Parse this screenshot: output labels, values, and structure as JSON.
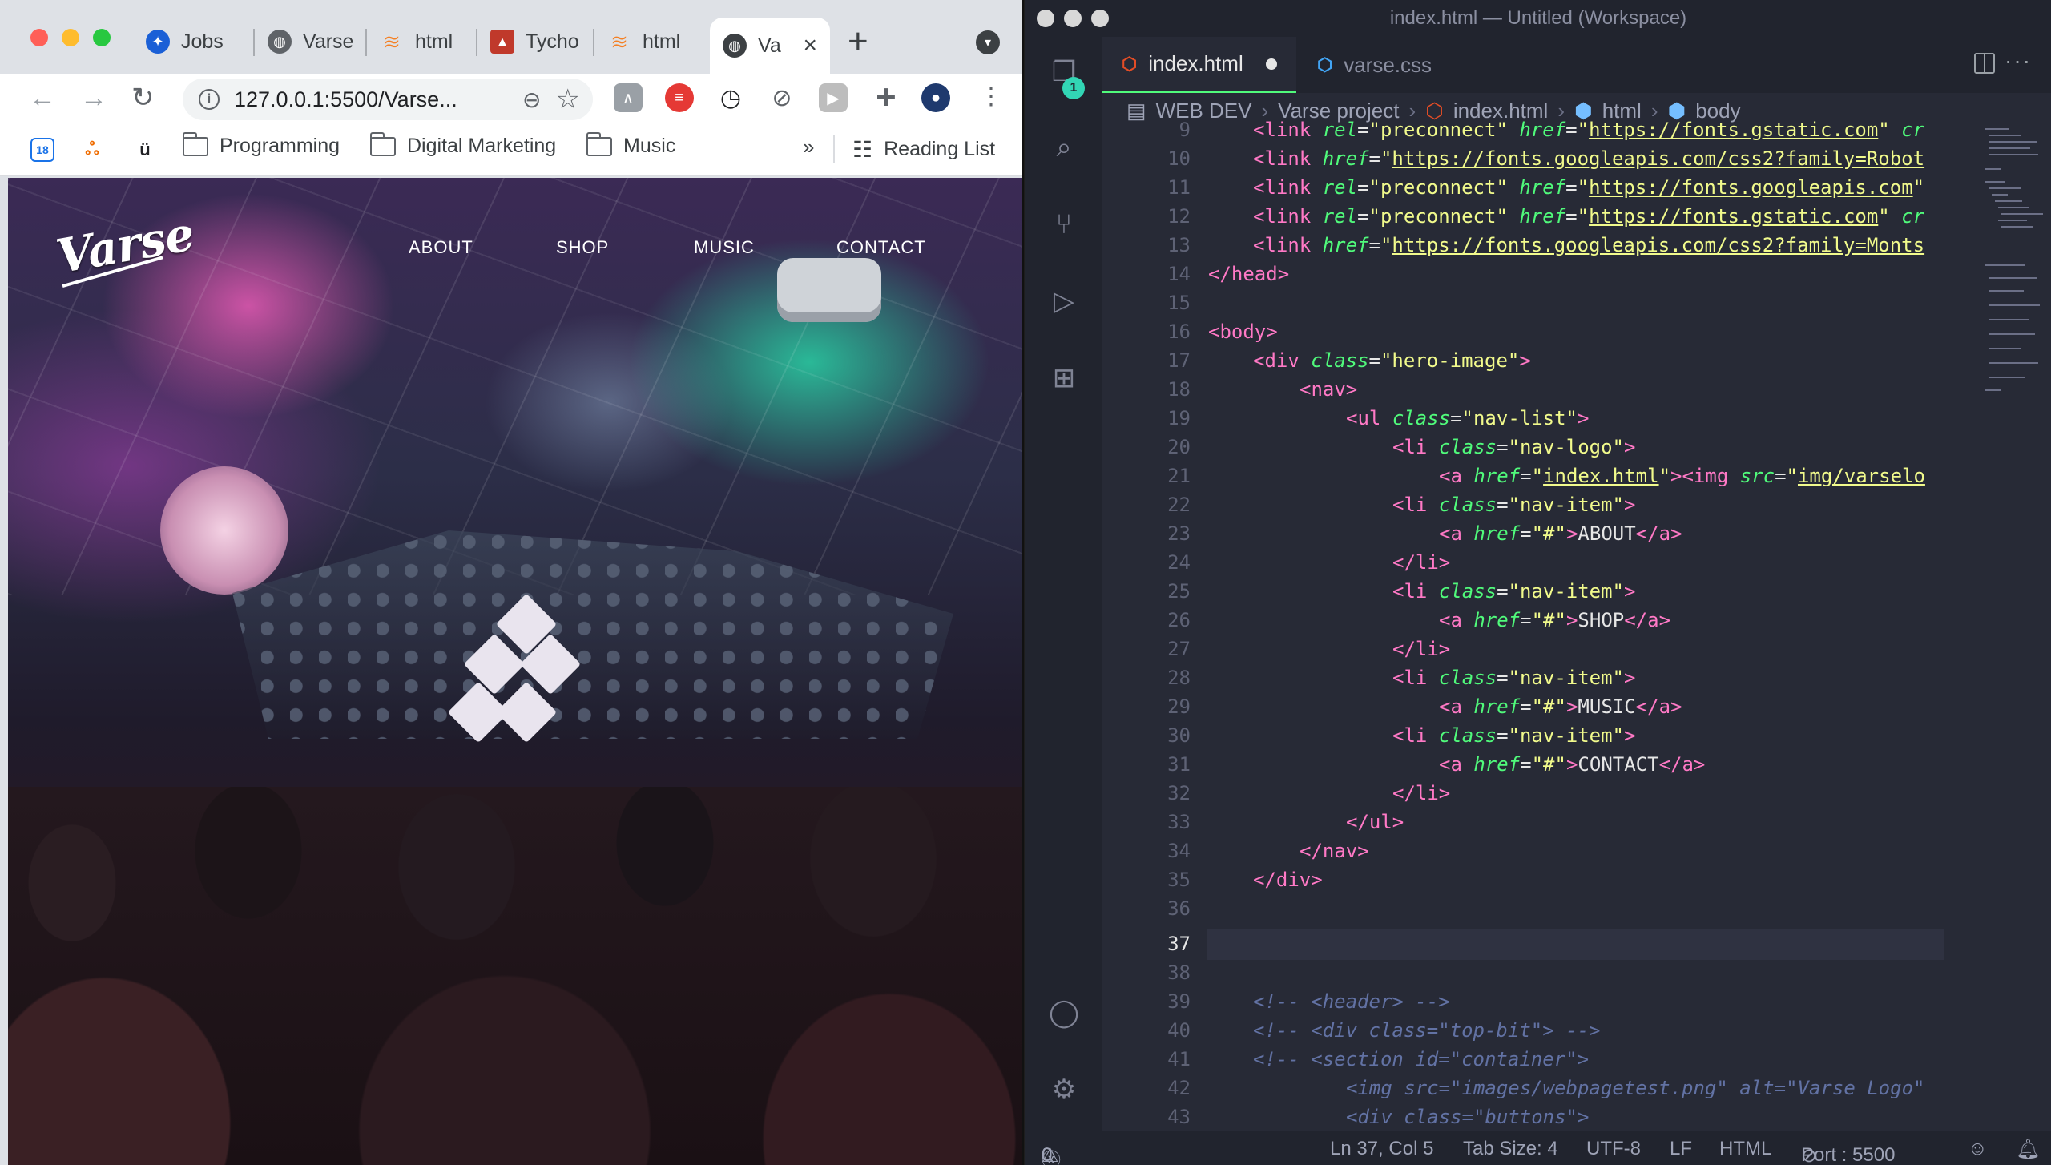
{
  "chrome": {
    "tabs": [
      {
        "label": "Jobs",
        "icon": "globe-icon",
        "color": "#1a5fd6"
      },
      {
        "label": "Varse",
        "icon": "globe-icon",
        "color": "#5f6368"
      },
      {
        "label": "html",
        "icon": "stackoverflow-icon",
        "color": "#f48024"
      },
      {
        "label": "Tycho",
        "icon": "tycho-icon",
        "color": "#c0392b"
      },
      {
        "label": "html",
        "icon": "stackoverflow-icon",
        "color": "#f48024"
      },
      {
        "label": "Va",
        "icon": "globe-icon",
        "color": "#5f6368",
        "active": true
      }
    ],
    "url": "127.0.0.1:5500/Varse...",
    "bookmarks": [
      {
        "label": "Programming"
      },
      {
        "label": "Digital Marketing"
      },
      {
        "label": "Music"
      }
    ],
    "bookmarks_overflow": "»",
    "reading_list": "Reading List",
    "calendar_day": "18"
  },
  "site": {
    "logo": "Varse",
    "nav": [
      "ABOUT",
      "SHOP",
      "MUSIC",
      "CONTACT"
    ]
  },
  "vscode": {
    "title": "index.html — Untitled (Workspace)",
    "badge_count": "1",
    "tabs": [
      {
        "label": "index.html",
        "modified": true,
        "active": true
      },
      {
        "label": "varse.css",
        "active": false
      }
    ],
    "breadcrumb": [
      "WEB DEV",
      "Varse project",
      "index.html",
      "html",
      "body"
    ],
    "lines": [
      {
        "n": "9"
      },
      {
        "n": "10"
      },
      {
        "n": "11"
      },
      {
        "n": "12"
      },
      {
        "n": "13"
      },
      {
        "n": "14"
      },
      {
        "n": "15"
      },
      {
        "n": "16"
      },
      {
        "n": "17"
      },
      {
        "n": "18"
      },
      {
        "n": "19"
      },
      {
        "n": "20"
      },
      {
        "n": "21"
      },
      {
        "n": "22"
      },
      {
        "n": "23"
      },
      {
        "n": "24"
      },
      {
        "n": "25"
      },
      {
        "n": "26"
      },
      {
        "n": "27"
      },
      {
        "n": "28"
      },
      {
        "n": "29"
      },
      {
        "n": "30"
      },
      {
        "n": "31"
      },
      {
        "n": "32"
      },
      {
        "n": "33"
      },
      {
        "n": "34"
      },
      {
        "n": "35"
      },
      {
        "n": "36"
      },
      {
        "n": "37"
      },
      {
        "n": "38"
      },
      {
        "n": "39"
      },
      {
        "n": "40"
      },
      {
        "n": "41"
      },
      {
        "n": "42"
      },
      {
        "n": "43"
      }
    ],
    "status": {
      "errors": "0",
      "warnings": "0",
      "position": "Ln 37, Col 5",
      "tab_size": "Tab Size: 4",
      "encoding": "UTF-8",
      "eol": "LF",
      "language": "HTML",
      "port": "Port : 5500"
    }
  },
  "colors": {
    "tag": "#ff79c6",
    "attr": "#50fa7b",
    "string": "#f1fa8c",
    "comment": "#6272a4"
  }
}
